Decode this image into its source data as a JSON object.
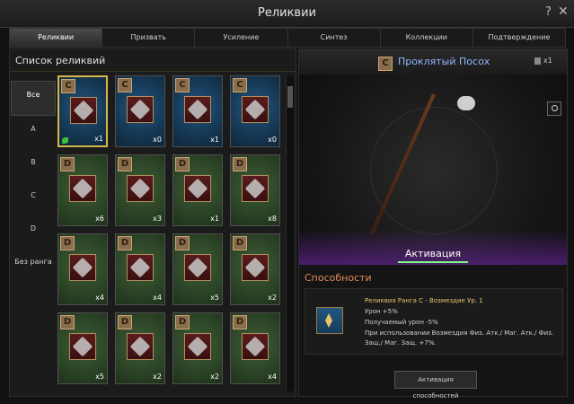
{
  "window": {
    "title": "Реликвии",
    "help": "?",
    "close": "✕"
  },
  "tabs": [
    {
      "label": "Реликвии",
      "active": true
    },
    {
      "label": "Призвать"
    },
    {
      "label": "Усиление"
    },
    {
      "label": "Синтез"
    },
    {
      "label": "Коллекции"
    },
    {
      "label": "Подтверждение"
    }
  ],
  "list": {
    "title": "Список реликвий",
    "ranks": [
      "Все",
      "A",
      "B",
      "C",
      "D",
      "Без ранга"
    ]
  },
  "relics": [
    {
      "rank": "C",
      "count": "x1",
      "color": "blue",
      "selected": true,
      "leaf": true
    },
    {
      "rank": "C",
      "count": "x0",
      "color": "blue"
    },
    {
      "rank": "C",
      "count": "x1",
      "color": "blue"
    },
    {
      "rank": "C",
      "count": "x0",
      "color": "blue"
    },
    {
      "rank": "D",
      "count": "x6",
      "color": "green"
    },
    {
      "rank": "D",
      "count": "x3",
      "color": "green"
    },
    {
      "rank": "D",
      "count": "x1",
      "color": "green"
    },
    {
      "rank": "D",
      "count": "x8",
      "color": "green"
    },
    {
      "rank": "D",
      "count": "x4",
      "color": "green"
    },
    {
      "rank": "D",
      "count": "x4",
      "color": "green"
    },
    {
      "rank": "D",
      "count": "x5",
      "color": "green"
    },
    {
      "rank": "D",
      "count": "x2",
      "color": "green"
    },
    {
      "rank": "D",
      "count": "x5",
      "color": "green"
    },
    {
      "rank": "D",
      "count": "x2",
      "color": "green"
    },
    {
      "rank": "D",
      "count": "x2",
      "color": "green"
    },
    {
      "rank": "D",
      "count": "x4",
      "color": "green"
    }
  ],
  "detail": {
    "rank": "C",
    "name": "Проклятый Посох",
    "owned": "x1",
    "activation": "Активация",
    "abilities_title": "Способности",
    "ability_head": "Реликвия Ранга С - Возмездие Ур. 1",
    "ability_lines": [
      "Урон +5%",
      "Получаемый урон -5%",
      "При использовании Возмездия Физ. Атк./ Маг. Атк./ Физ. Защ./ Маг. Защ. +7%."
    ],
    "activate_button": "Активация способностей"
  }
}
